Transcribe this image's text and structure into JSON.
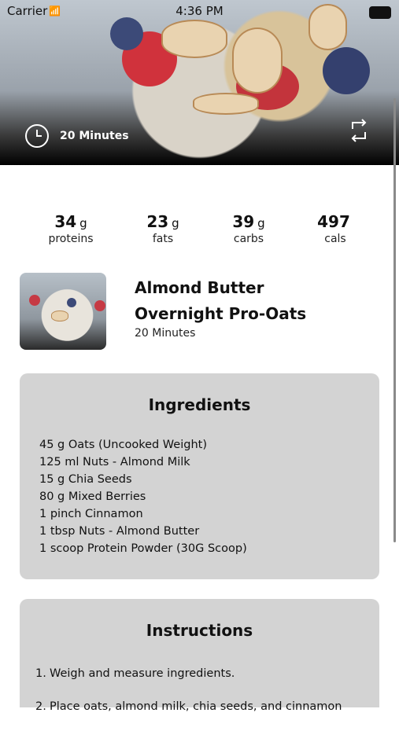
{
  "status_bar": {
    "carrier": "Carrier",
    "time": "4:36 PM"
  },
  "hero": {
    "duration": "20 Minutes"
  },
  "nutrition": [
    {
      "value": "34",
      "unit": "g",
      "label": "proteins"
    },
    {
      "value": "23",
      "unit": "g",
      "label": "fats"
    },
    {
      "value": "39",
      "unit": "g",
      "label": "carbs"
    },
    {
      "value": "497",
      "unit": "",
      "label": "cals"
    }
  ],
  "recipe": {
    "title_line1": "Almond Butter",
    "title_line2": "Overnight Pro-Oats",
    "time": "20 Minutes"
  },
  "ingredients": {
    "heading": "Ingredients",
    "items": [
      "45 g Oats (Uncooked Weight)",
      "125 ml Nuts - Almond Milk",
      "15 g Chia Seeds",
      "80 g Mixed Berries",
      "1 pinch Cinnamon",
      "1 tbsp Nuts - Almond Butter",
      "1 scoop Protein Powder (30G Scoop)"
    ]
  },
  "instructions": {
    "heading": "Instructions",
    "items": [
      {
        "num": "1.",
        "text": "Weigh and measure ingredients."
      },
      {
        "num": "2.",
        "text": "Place oats, almond milk, chia seeds, and cinnamon"
      }
    ]
  }
}
